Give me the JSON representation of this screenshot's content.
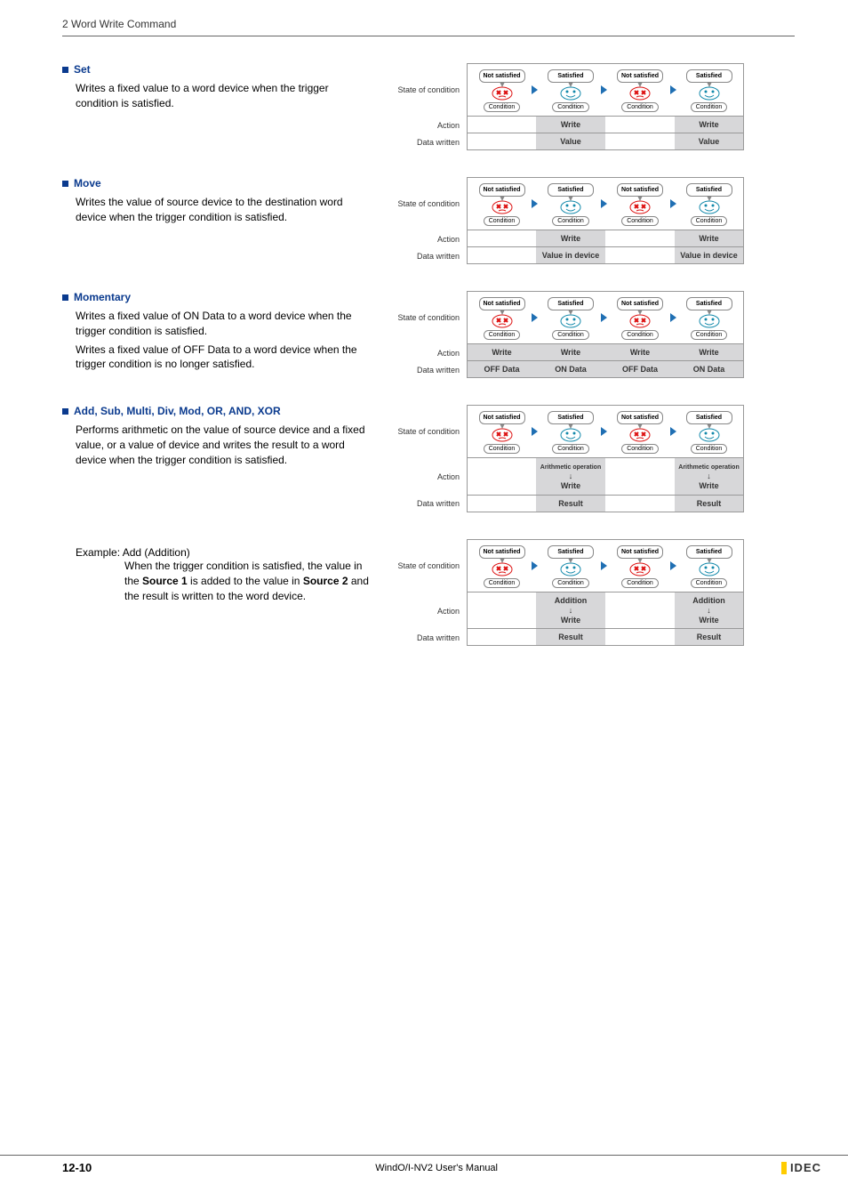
{
  "header": "2 Word Write Command",
  "sections": {
    "set": {
      "title": "Set",
      "desc": "Writes a fixed value to a word device when the trigger condition is satisfied.",
      "states": [
        "Not satisfied",
        "Satisfied",
        "Not satisfied",
        "Satisfied"
      ],
      "actions": [
        "",
        "Write",
        "",
        "Write"
      ],
      "data": [
        "",
        "Value",
        "",
        "Value"
      ],
      "row_labels": [
        "State of condition",
        "Action",
        "Data written"
      ]
    },
    "move": {
      "title": "Move",
      "desc": "Writes the value of source device to the destination word device when the trigger condition is satisfied.",
      "states": [
        "Not satisfied",
        "Satisfied",
        "Not satisfied",
        "Satisfied"
      ],
      "actions": [
        "",
        "Write",
        "",
        "Write"
      ],
      "data": [
        "",
        "Value in device",
        "",
        "Value in device"
      ],
      "row_labels": [
        "State of condition",
        "Action",
        "Data written"
      ]
    },
    "momentary": {
      "title": "Momentary",
      "desc1": "Writes a fixed value of ON Data to a word device when the trigger condition is satisfied.",
      "desc2": "Writes a fixed value of OFF Data to a word device when the trigger condition is no longer satisfied.",
      "states": [
        "Not satisfied",
        "Satisfied",
        "Not satisfied",
        "Satisfied"
      ],
      "actions": [
        "Write",
        "Write",
        "Write",
        "Write"
      ],
      "data": [
        "OFF Data",
        "ON Data",
        "OFF Data",
        "ON Data"
      ],
      "row_labels": [
        "State of condition",
        "Action",
        "Data written"
      ]
    },
    "arith": {
      "title": "Add, Sub, Multi, Div, Mod, OR, AND, XOR",
      "desc": "Performs arithmetic on the value of source device and a fixed value, or a value of device and writes the result to a word device when the trigger condition is satisfied.",
      "states": [
        "Not satisfied",
        "Satisfied",
        "Not satisfied",
        "Satisfied"
      ],
      "actions_op": "Arithmetic operation",
      "actions_wr": "Write",
      "data": [
        "",
        "Result",
        "",
        "Result"
      ],
      "row_labels": [
        "State of condition",
        "Action",
        "Data written"
      ]
    },
    "example": {
      "lead": "Example: Add (Addition)",
      "body1": "When the trigger condition is satisfied, the value in the ",
      "src1": "Source 1",
      "body2": " is added to the value in ",
      "src2": "Source 2",
      "body3": " and the result is written to the word device.",
      "states": [
        "Not satisfied",
        "Satisfied",
        "Not satisfied",
        "Satisfied"
      ],
      "actions_op": "Addition",
      "actions_wr": "Write",
      "data": [
        "",
        "Result",
        "",
        "Result"
      ],
      "row_labels": [
        "State of condition",
        "Action",
        "Data written"
      ]
    }
  },
  "diag": {
    "condition": "Condition",
    "arrow": "↓"
  },
  "footer": {
    "page": "12-10",
    "title": "WindO/I-NV2 User's Manual",
    "brand": "IDEC"
  }
}
